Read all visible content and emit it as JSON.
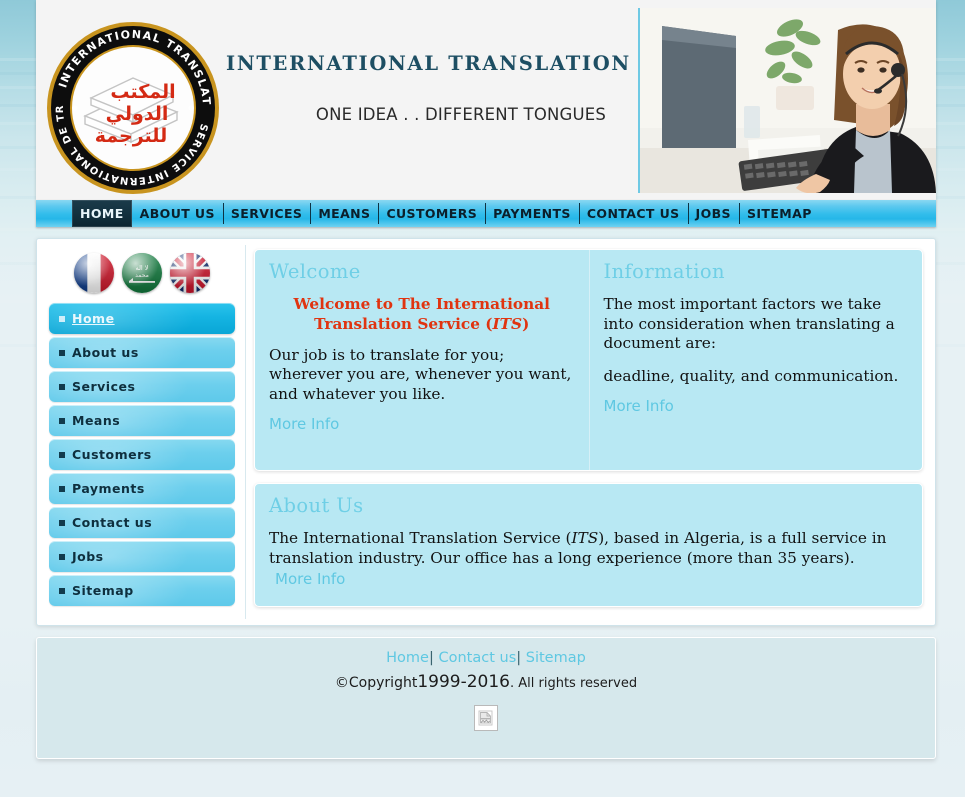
{
  "site": {
    "title": "INTERNATIONAL TRANSLATION SERVICE",
    "tagline": "ONE IDEA . . DIFFERENT TONGUES",
    "logo_alt": "its-logo",
    "header_photo_alt": "call-center-operator-photo"
  },
  "nav": {
    "items": [
      {
        "label": "HOME",
        "active": true
      },
      {
        "label": "ABOUT US",
        "active": false
      },
      {
        "label": "SERVICES",
        "active": false
      },
      {
        "label": "MEANS",
        "active": false
      },
      {
        "label": "CUSTOMERS",
        "active": false
      },
      {
        "label": "PAYMENTS",
        "active": false
      },
      {
        "label": "CONTACT US",
        "active": false
      },
      {
        "label": "JOBS",
        "active": false
      },
      {
        "label": "SITEMAP",
        "active": false
      }
    ]
  },
  "sidebar": {
    "flags": [
      {
        "name": "flag-france",
        "title": "French"
      },
      {
        "name": "flag-saudi-arabia",
        "title": "Arabic"
      },
      {
        "name": "flag-united-kingdom",
        "title": "English"
      }
    ],
    "items": [
      {
        "label": "Home",
        "active": true
      },
      {
        "label": "About us",
        "active": false
      },
      {
        "label": "Services",
        "active": false
      },
      {
        "label": "Means",
        "active": false
      },
      {
        "label": "Customers",
        "active": false
      },
      {
        "label": "Payments",
        "active": false
      },
      {
        "label": "Contact us",
        "active": false
      },
      {
        "label": "Jobs",
        "active": false
      },
      {
        "label": "Sitemap",
        "active": false
      }
    ]
  },
  "welcome": {
    "title": "Welcome",
    "headline_a": "Welcome to The International Translation Service (",
    "headline_its": "ITS",
    "headline_b": ")",
    "paragraph": "Our job is to translate for you; wherever you are, whenever you want, and whatever you like.",
    "more_info": "More Info"
  },
  "information": {
    "title": "Information",
    "paragraph_1": "The most important factors we take into consideration when translating a document are:",
    "paragraph_2": "deadline, quality, and communication.",
    "more_info": "More Info"
  },
  "about": {
    "title": "About Us",
    "text_a": "The International Translation Service (",
    "text_its": "ITS",
    "text_b": "), based in Algeria, is a full service in translation industry. Our office has a long experience (more than 35 years).",
    "more_info": "More Info"
  },
  "footer": {
    "links": [
      {
        "label": "Home"
      },
      {
        "label": "Contact us"
      },
      {
        "label": "Sitemap"
      }
    ],
    "separator_1": "|",
    "separator_2": "|",
    "copyright_prefix": "©Copyright",
    "copyright_years": "1999-2016",
    "copyright_suffix": ". All rights reserved",
    "badge_icon": "broken-image-icon"
  },
  "colors": {
    "nav_bg": "#32bdeb",
    "nav_active_bg": "#12303e",
    "panel_bg": "#b8e8f3",
    "panel_title": "#6fcfe6",
    "accent_red": "#e03410",
    "title_teal": "#1d4e63",
    "footer_bg": "#d6e8ec",
    "page_bg": "#e7f1f4"
  }
}
